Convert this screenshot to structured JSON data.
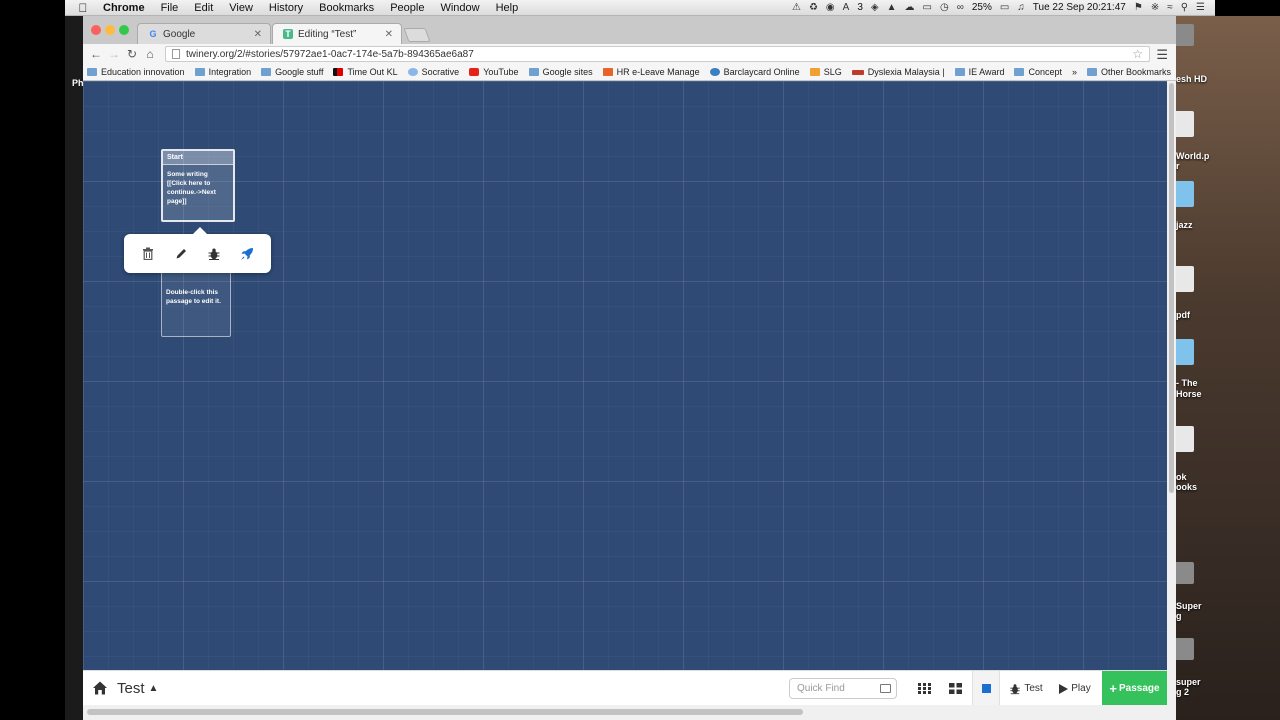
{
  "menubar": {
    "app_name": "Chrome",
    "items": [
      "File",
      "Edit",
      "View",
      "History",
      "Bookmarks",
      "People",
      "Window",
      "Help"
    ],
    "battery": "25%",
    "datetime": "Tue 22 Sep  20:21:47",
    "adobe_count": "3"
  },
  "tabs": [
    {
      "title": "Google",
      "favicon": "G"
    },
    {
      "title": "Editing “Test”",
      "favicon": "T"
    }
  ],
  "address": {
    "url": "twinery.org/2/#stories/57972ae1-0ac7-174e-5a7b-894365ae6a87"
  },
  "bookmarks": {
    "items": [
      "Education innovation",
      "Integration",
      "Google stuff",
      "Time Out KL",
      "Socrative",
      "YouTube",
      "Google sites",
      "HR e-Leave Manage",
      "Barclaycard Online",
      "SLG",
      "Dyslexia Malaysia |",
      "IE Award",
      "Concept"
    ],
    "overflow": "»",
    "other": "Other Bookmarks"
  },
  "passages": [
    {
      "title": "Start",
      "excerpt": "Some writing [[Click here to continue.->Next page]]"
    },
    {
      "title": "",
      "excerpt": "Double-click this passage to edit it."
    }
  ],
  "storybar": {
    "story_name": "Test",
    "quick_find_placeholder": "Quick Find",
    "test_label": "Test",
    "play_label": "Play",
    "passage_label": "Passage",
    "add_symbol": "+"
  },
  "desktop": {
    "left_label": "Ph",
    "labels": [
      "esh HD",
      "World.p",
      "r",
      "jazz",
      "pdf",
      "- The",
      "Horse",
      "ok",
      "ooks",
      "Super",
      "g",
      "super",
      "g 2"
    ]
  },
  "colors": {
    "canvas": "#2e4a75",
    "add_passage": "#35c15b",
    "start_highlight": "#1a6fd1"
  }
}
